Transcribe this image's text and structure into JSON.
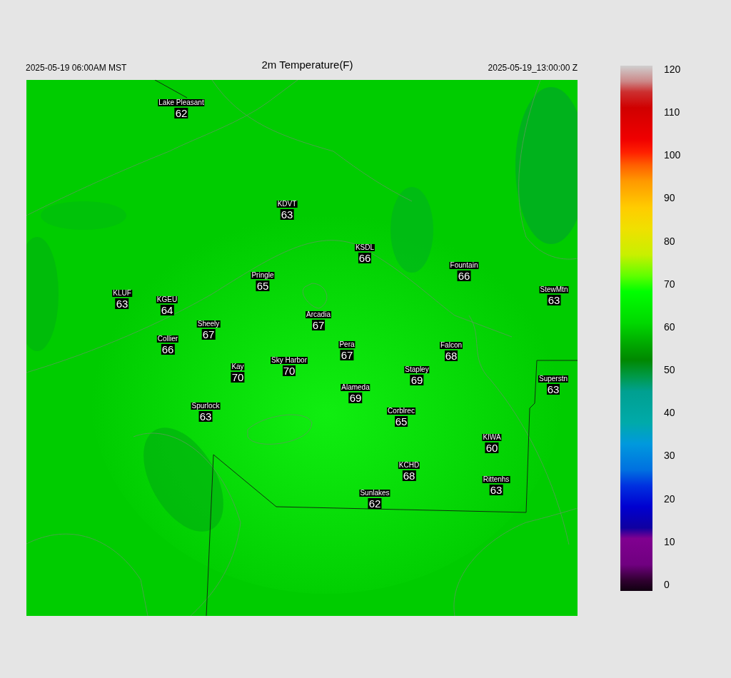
{
  "header": {
    "valid_local": "2025-05-19 06:00AM MST",
    "title": "2m Temperature(F)",
    "valid_utc": "2025-05-19_13:00:00 Z"
  },
  "stations": [
    {
      "name": "Lake Pleasant",
      "value": "62"
    },
    {
      "name": "KDVT",
      "value": "63"
    },
    {
      "name": "KSDL",
      "value": "66"
    },
    {
      "name": "Fountain",
      "value": "66"
    },
    {
      "name": "Pringle",
      "value": "65"
    },
    {
      "name": "StewMtn",
      "value": "63"
    },
    {
      "name": "KLUF",
      "value": "63"
    },
    {
      "name": "KGEU",
      "value": "64"
    },
    {
      "name": "Arcadia",
      "value": "67"
    },
    {
      "name": "Sheely",
      "value": "67"
    },
    {
      "name": "Collier",
      "value": "66"
    },
    {
      "name": "Pera",
      "value": "67"
    },
    {
      "name": "Falcon",
      "value": "68"
    },
    {
      "name": "Sky Harbor",
      "value": "70"
    },
    {
      "name": "Kay",
      "value": "70"
    },
    {
      "name": "Stapley",
      "value": "69"
    },
    {
      "name": "Superstn",
      "value": "63"
    },
    {
      "name": "Alameda",
      "value": "69"
    },
    {
      "name": "Spurlock",
      "value": "63"
    },
    {
      "name": "Corblrec",
      "value": "65"
    },
    {
      "name": "KIWA",
      "value": "60"
    },
    {
      "name": "KCHD",
      "value": "68"
    },
    {
      "name": "Rittenhs",
      "value": "63"
    },
    {
      "name": "Sunlakes",
      "value": "62"
    }
  ],
  "colorbar": {
    "ticks": [
      "120",
      "110",
      "100",
      "90",
      "80",
      "70",
      "60",
      "50",
      "40",
      "30",
      "20",
      "10",
      "0"
    ]
  }
}
